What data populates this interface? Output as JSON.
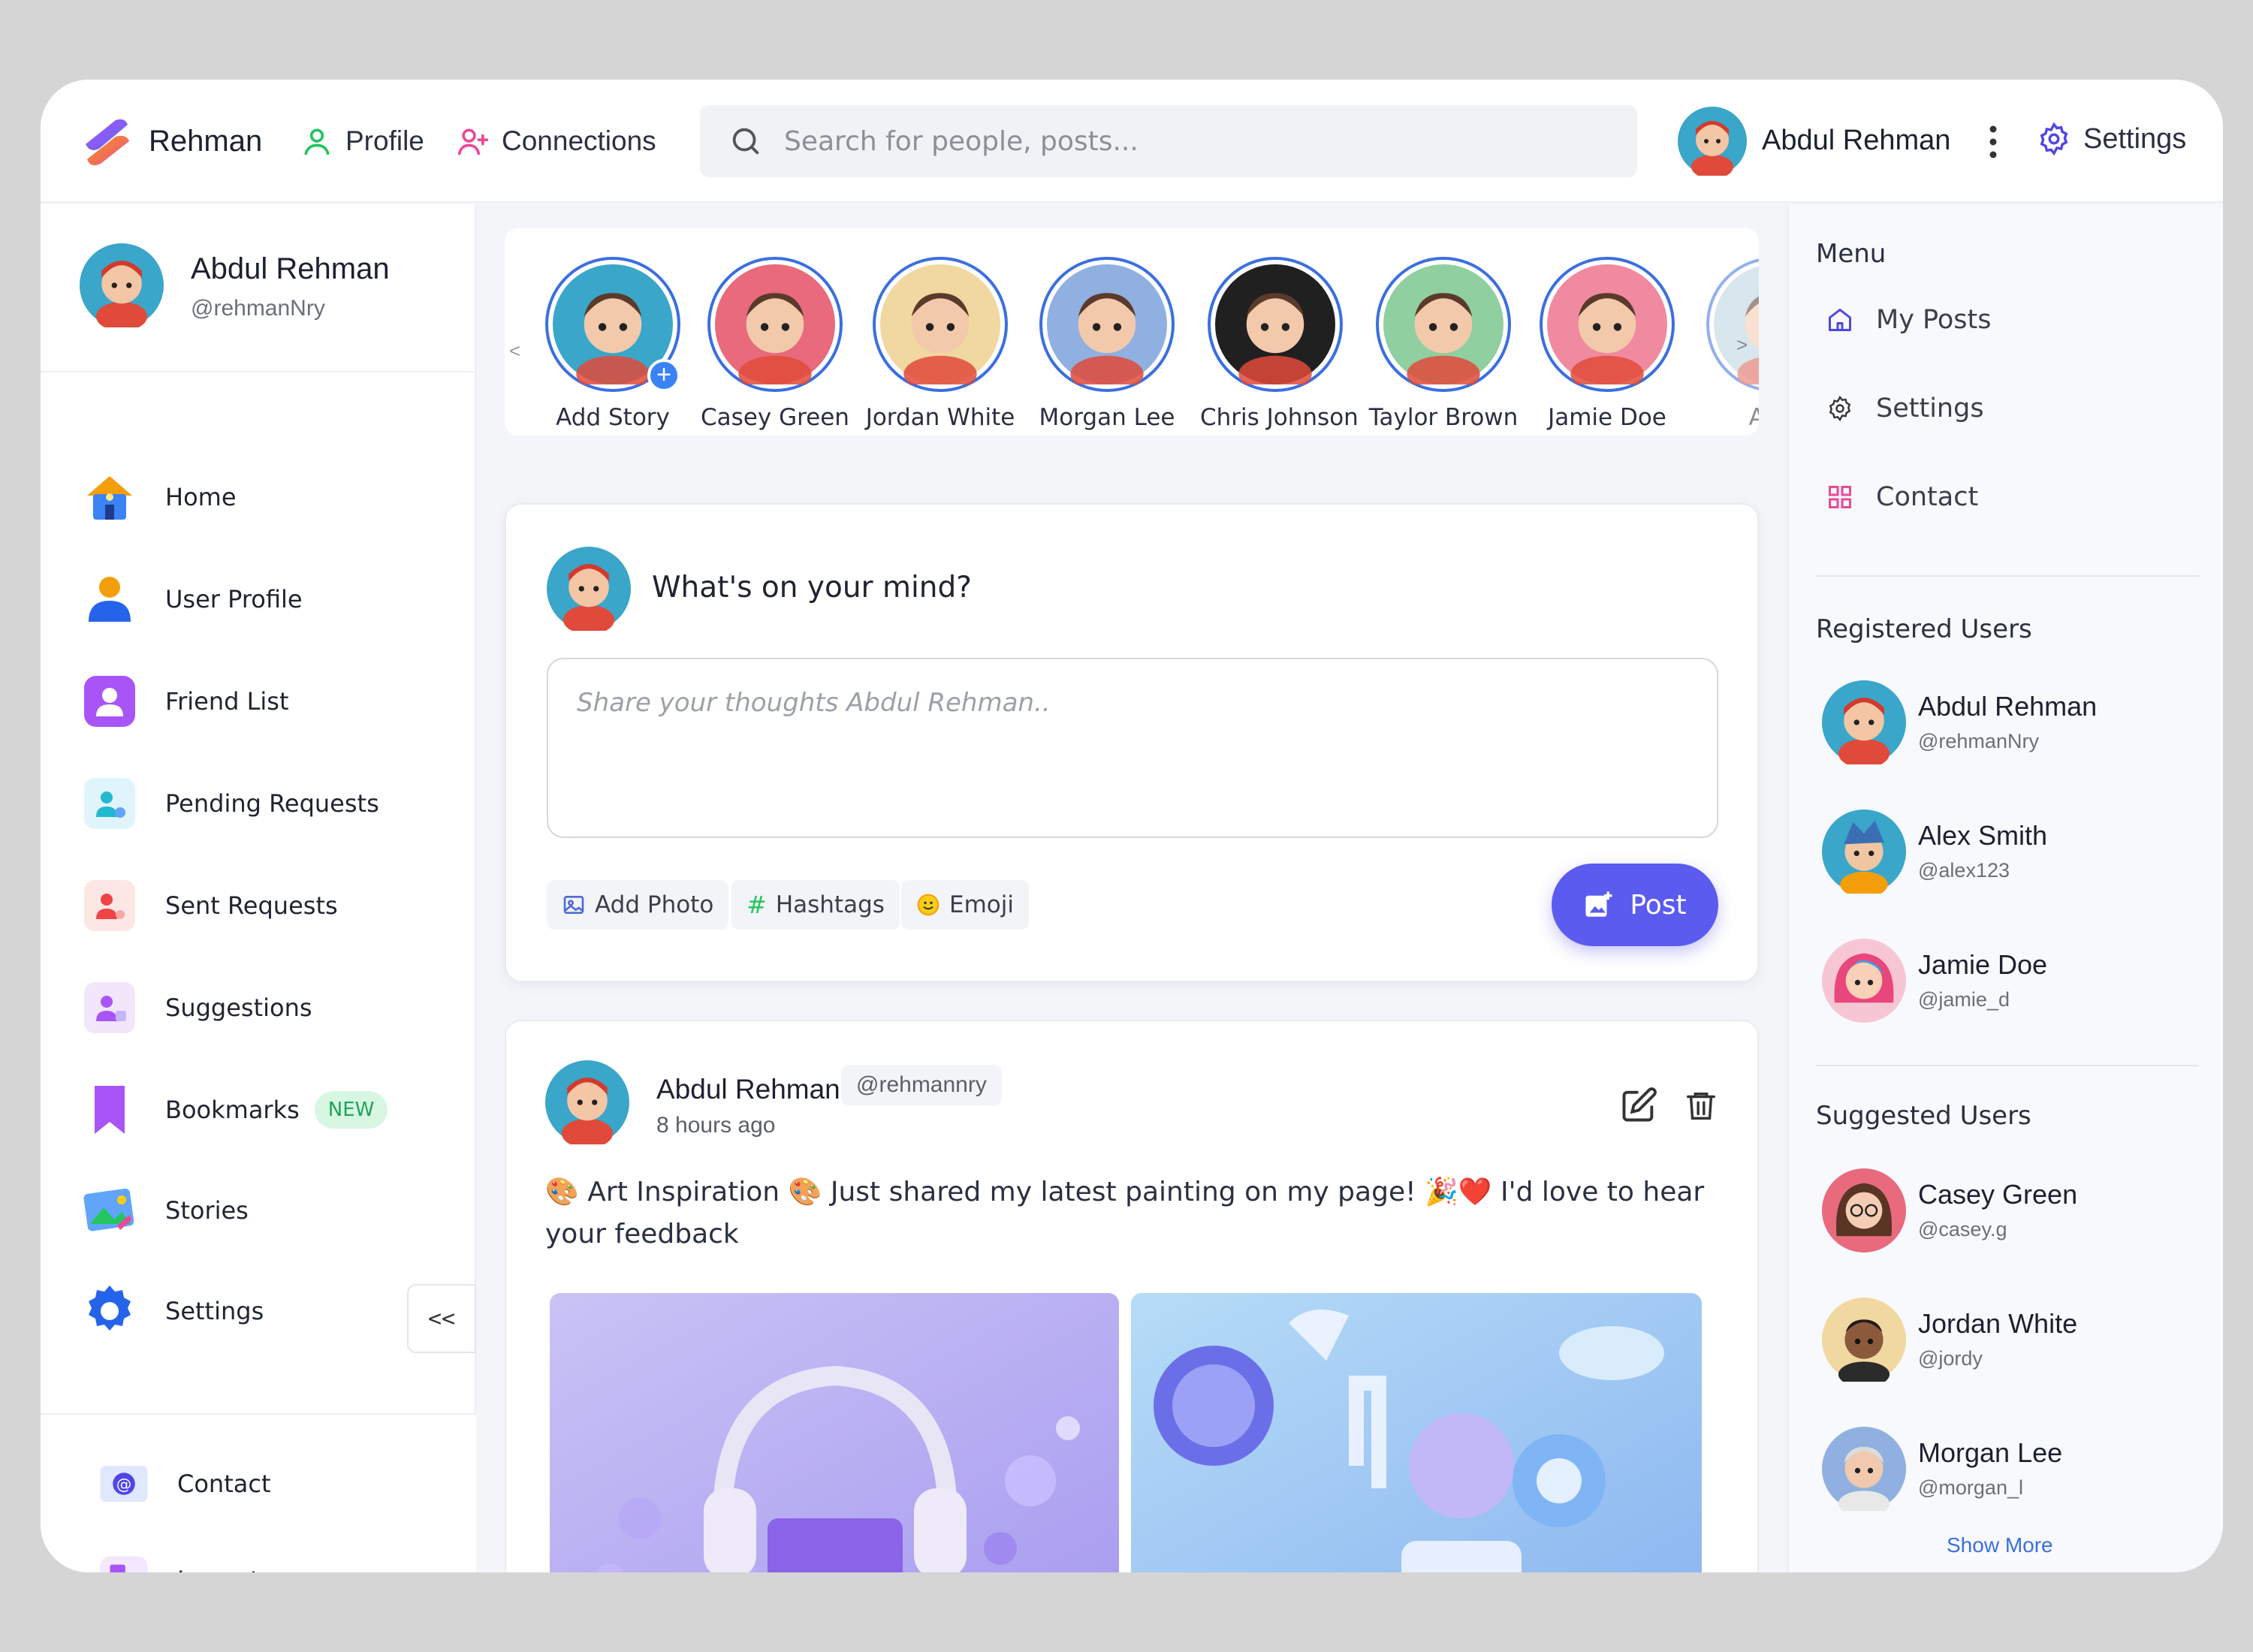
{
  "colors": {
    "accent": "#5b5bf0",
    "story_ring": "#3b6fe0",
    "new_badge_bg": "#d7f7e3",
    "new_badge_text": "#21a259",
    "profile_icon": "#22c55e",
    "connections_icon": "#ec4899",
    "settings_icon": "#4f46e5"
  },
  "header": {
    "brand": "Rehman",
    "nav": [
      {
        "label": "Profile",
        "icon": "user-icon"
      },
      {
        "label": "Connections",
        "icon": "user-plus-icon"
      }
    ],
    "search_placeholder": "Search for people, posts...",
    "user_name": "Abdul Rehman",
    "settings_label": "Settings"
  },
  "sidebar": {
    "profile": {
      "name": "Abdul Rehman",
      "handle": "@rehmanNry"
    },
    "items": [
      {
        "label": "Home",
        "icon": "house-icon"
      },
      {
        "label": "User Profile",
        "icon": "person-icon"
      },
      {
        "label": "Friend List",
        "icon": "friend-list-icon"
      },
      {
        "label": "Pending Requests",
        "icon": "pending-user-icon"
      },
      {
        "label": "Sent Requests",
        "icon": "sent-user-icon"
      },
      {
        "label": "Suggestions",
        "icon": "suggestions-icon"
      },
      {
        "label": "Bookmarks",
        "icon": "bookmark-icon",
        "badge": "NEW"
      },
      {
        "label": "Stories",
        "icon": "stories-icon"
      },
      {
        "label": "Settings",
        "icon": "gear-icon"
      }
    ],
    "collapse_label": "<<",
    "footer": [
      {
        "label": "Contact",
        "icon": "at-icon"
      },
      {
        "label": "Logout",
        "icon": "logout-icon"
      }
    ]
  },
  "stories": [
    {
      "label": "Add Story",
      "color": "#3aa6c9"
    },
    {
      "label": "Casey Green",
      "color": "#e86a7c"
    },
    {
      "label": "Jordan White",
      "color": "#f1d7a0"
    },
    {
      "label": "Morgan Lee",
      "color": "#8fb0e0"
    },
    {
      "label": "Chris Johnson",
      "color": "#202020"
    },
    {
      "label": "Taylor Brown",
      "color": "#8fcfa0"
    },
    {
      "label": "Jamie Doe",
      "color": "#f08aa0"
    },
    {
      "label": "Alex",
      "color": "#b8d4e0"
    }
  ],
  "composer": {
    "prompt": "What's on your mind?",
    "placeholder": "Share your thoughts Abdul Rehman..",
    "chips": [
      {
        "label": "Add Photo",
        "icon": "image-icon"
      },
      {
        "label": "Hashtags",
        "icon": "hashtag-icon"
      },
      {
        "label": "Emoji",
        "icon": "emoji-icon"
      }
    ],
    "post_label": "Post"
  },
  "post": {
    "author": "Abdul Rehman",
    "handle": "@rehmannry",
    "time": "8 hours ago",
    "text": "🎨 Art Inspiration 🎨 Just shared my latest painting on my page! 🎉❤️ I'd love to hear your feedback"
  },
  "right": {
    "menu_title": "Menu",
    "menu": [
      {
        "label": "My Posts",
        "icon": "home-outline-icon"
      },
      {
        "label": "Settings",
        "icon": "gear-outline-icon"
      },
      {
        "label": "Contact",
        "icon": "grid-icon"
      }
    ],
    "registered_title": "Registered Users",
    "registered": [
      {
        "name": "Abdul Rehman",
        "handle": "@rehmanNry"
      },
      {
        "name": "Alex Smith",
        "handle": "@alex123"
      },
      {
        "name": "Jamie Doe",
        "handle": "@jamie_d"
      }
    ],
    "suggested_title": "Suggested Users",
    "suggested": [
      {
        "name": "Casey Green",
        "handle": "@casey.g"
      },
      {
        "name": "Jordan White",
        "handle": "@jordy"
      },
      {
        "name": "Morgan Lee",
        "handle": "@morgan_l"
      }
    ],
    "show_more": "Show More"
  }
}
